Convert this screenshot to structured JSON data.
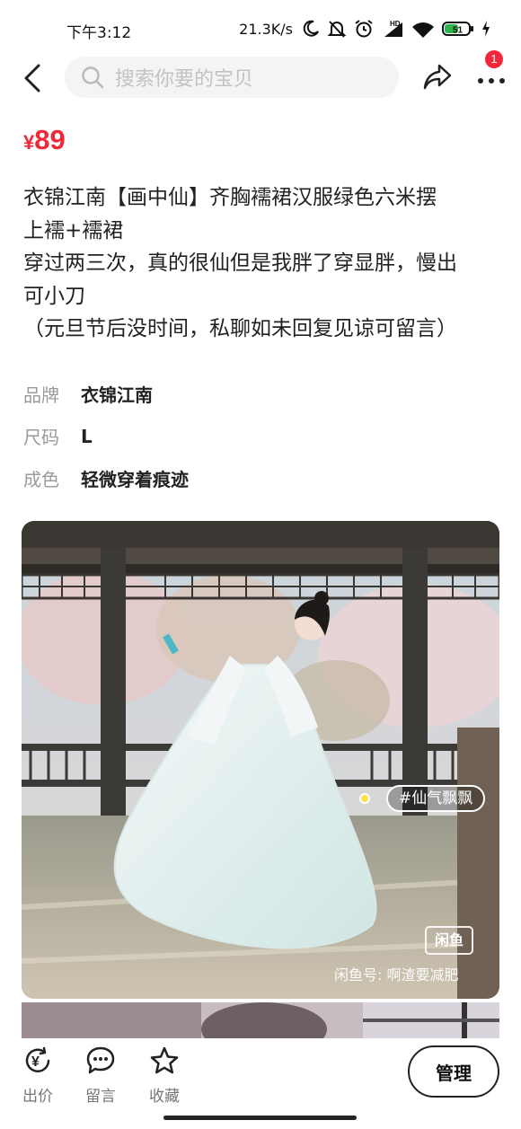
{
  "status_bar": {
    "time": "下午3:12",
    "network_speed": "21.3K/s",
    "battery": "51",
    "icons": [
      "moon-icon",
      "mute-bell-icon",
      "alarm-icon",
      "hd-signal-icon",
      "wifi-icon",
      "battery-icon",
      "charging-icon"
    ]
  },
  "top_bar": {
    "search_placeholder": "搜索你要的宝贝",
    "notification_count": "1",
    "icons": [
      "back-icon",
      "search-icon",
      "share-icon",
      "more-icon"
    ]
  },
  "item": {
    "price_currency": "¥",
    "price_value": "89",
    "description_lines": [
      "衣锦江南【画中仙】齐胸襦裙汉服绿色六米摆",
      "上襦+襦裙",
      "穿过两三次，真的很仙但是我胖了穿显胖，慢出",
      "可小刀",
      "（元旦节后没时间，私聊如未回复见谅可留言）"
    ],
    "attributes": [
      {
        "label": "品牌",
        "value": "衣锦江南"
      },
      {
        "label": "尺码",
        "value": "L"
      },
      {
        "label": "成色",
        "value": "轻微穿着痕迹"
      }
    ]
  },
  "photo": {
    "tag": "#仙气飘飘",
    "watermark_logo": "闲鱼",
    "watermark_text": "闲鱼号: 啊渣要减肥"
  },
  "bottom_bar": {
    "tools": [
      {
        "label": "出价",
        "icon": "yuan-price-icon"
      },
      {
        "label": "留言",
        "icon": "comment-icon"
      },
      {
        "label": "收藏",
        "icon": "star-icon"
      }
    ],
    "manage_label": "管理"
  },
  "colors": {
    "accent": "#f2283a",
    "muted_text": "#9a9a9a",
    "search_bg": "#f4f4f4"
  }
}
